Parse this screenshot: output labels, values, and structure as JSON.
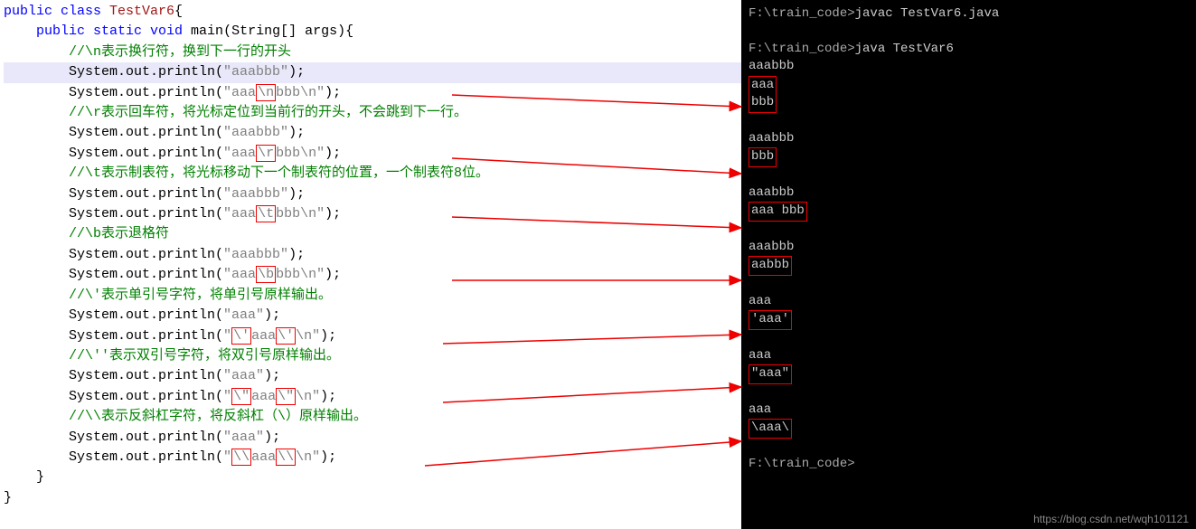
{
  "code": {
    "l1a": "public",
    "l1b": " class ",
    "l1c": "TestVar6",
    "l1d": "{",
    "l2a": "    public static void ",
    "l2b": "main",
    "l2c": "(String[] args){",
    "l3": "        //\\n表示换行符，换到下一行的开头",
    "l4a": "        System.out.println(",
    "l4b": "\"aaabbb\"",
    "l4c": ");",
    "l5a": "        System.out.println(",
    "l5b": "\"aaa",
    "l5esc": "\\n",
    "l5c": "bbb\\n\"",
    "l5d": ");",
    "l6": "        //\\r表示回车符，将光标定位到当前行的开头，不会跳到下一行。",
    "l7a": "        System.out.println(",
    "l7b": "\"aaabbb\"",
    "l7c": ");",
    "l8a": "        System.out.println(",
    "l8b": "\"aaa",
    "l8esc": "\\r",
    "l8c": "bbb\\n\"",
    "l8d": ");",
    "l9": "        //\\t表示制表符，将光标移动下一个制表符的位置，一个制表符8位。",
    "l10a": "        System.out.println(",
    "l10b": "\"aaabbb\"",
    "l10c": ");",
    "l11a": "        System.out.println(",
    "l11b": "\"aaa",
    "l11esc": "\\t",
    "l11c": "bbb\\n\"",
    "l11d": ");",
    "l12": "        //\\b表示退格符",
    "l13a": "        System.out.println(",
    "l13b": "\"aaabbb\"",
    "l13c": ");",
    "l14a": "        System.out.println(",
    "l14b": "\"aaa",
    "l14esc": "\\b",
    "l14c": "bbb\\n\"",
    "l14d": ");",
    "l15": "        //\\'表示单引号字符，将单引号原样输出。",
    "l16a": "        System.out.println(",
    "l16b": "\"aaa\"",
    "l16c": ");",
    "l17a": "        System.out.println(",
    "l17b": "\"",
    "l17esc1": "\\'",
    "l17c": "aaa",
    "l17esc2": "\\'",
    "l17d": "\\n\"",
    "l17e": ");",
    "l18": "        //\\''表示双引号字符，将双引号原样输出。",
    "l19a": "        System.out.println(",
    "l19b": "\"aaa\"",
    "l19c": ");",
    "l20a": "        System.out.println(",
    "l20b": "\"",
    "l20esc1": "\\\"",
    "l20c": "aaa",
    "l20esc2": "\\\"",
    "l20d": "\\n\"",
    "l20e": ");",
    "l21": "        //\\\\表示反斜杠字符，将反斜杠（\\）原样输出。",
    "l22a": "        System.out.println(",
    "l22b": "\"aaa\"",
    "l22c": ");",
    "l23a": "        System.out.println(",
    "l23b": "\"",
    "l23esc1": "\\\\",
    "l23c": "aaa",
    "l23esc2": "\\\\",
    "l23d": "\\n\"",
    "l23e": ");",
    "l24": "    }",
    "l25": "}"
  },
  "term": {
    "p1": "F:\\train_code>",
    "c1": "javac TestVar6.java",
    "p2": "F:\\train_code>",
    "c2": "java TestVar6",
    "o1": "aaabbb",
    "o2a": "aaa",
    "o2b": "bbb",
    "o3": "aaabbb",
    "o4": "bbb",
    "o5": "aaabbb",
    "o6": "aaa     bbb",
    "o7": "aaabbb",
    "o8": "aabbb",
    "o9": "aaa",
    "o10": "'aaa'",
    "o11": "aaa",
    "o12": "\"aaa\"",
    "o13": "aaa",
    "o14": "\\aaa\\",
    "p3": "F:\\train_code>"
  },
  "watermark": "https://blog.csdn.net/wqh101121"
}
